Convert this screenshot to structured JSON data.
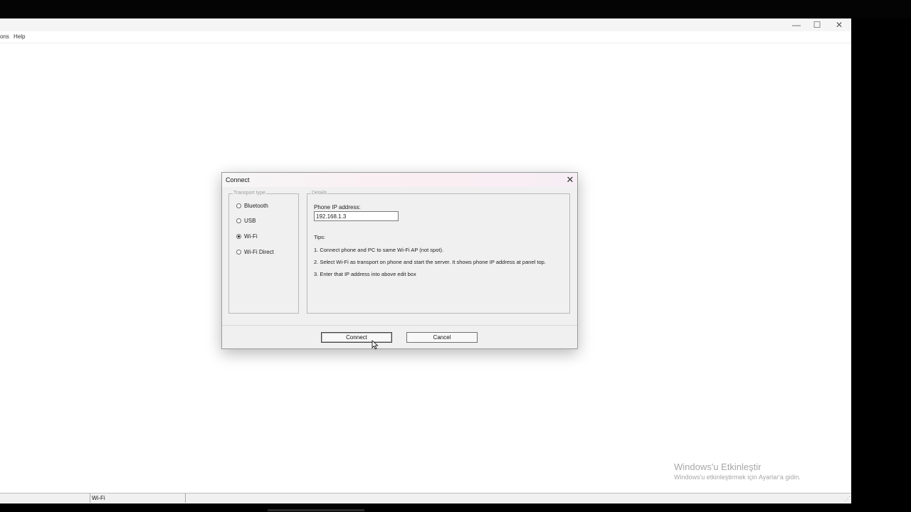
{
  "window": {
    "controls": {
      "minimize": "—",
      "maximize": "☐",
      "close": "✕"
    },
    "menu": [
      "ons",
      "Help"
    ]
  },
  "statusbar": {
    "transport": "Wi-Fi"
  },
  "activation": {
    "title": "Windows'u Etkinleştir",
    "subtitle": "Windows'u etkinleştirmek için Ayarlar'a gidin."
  },
  "dialog": {
    "title": "Connect",
    "transport_group_label": "Transport type",
    "transport_options": [
      {
        "label": "Bluetooth",
        "selected": false
      },
      {
        "label": "USB",
        "selected": false
      },
      {
        "label": "Wi-Fi",
        "selected": true
      },
      {
        "label": "Wi-Fi Direct",
        "selected": false
      }
    ],
    "details_group_label": "Details",
    "ip_label": "Phone IP address:",
    "ip_value": "192.168.1.3",
    "tips_heading": "Tips:",
    "tips": [
      "1. Connect phone and PC to same Wi-Fi AP (not spot).",
      "2. Select Wi-Fi as transport on phone and start the server. It shows phone IP address at panel top.",
      "3. Enter that IP address into above edit box"
    ],
    "connect_label": "Connect",
    "cancel_label": "Cancel"
  }
}
